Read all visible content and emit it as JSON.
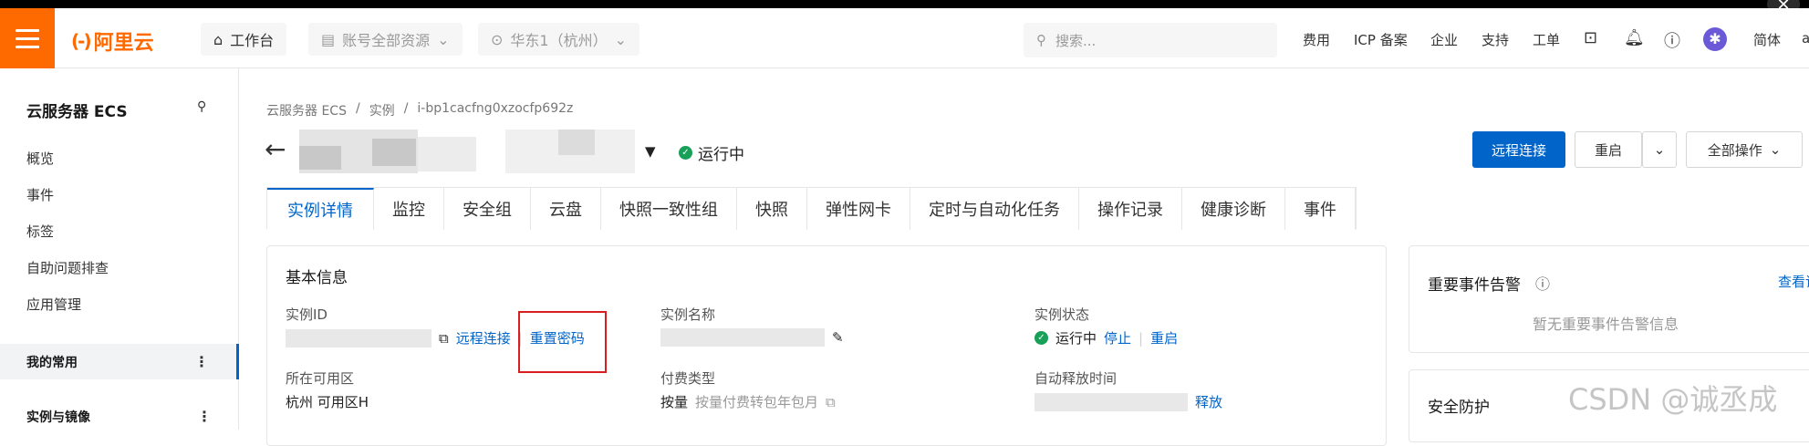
{
  "topbar": {
    "logo_mark": "(-)",
    "logo_text": "阿里云",
    "workbench": "工作台",
    "resources": "账号全部资源",
    "region": "华东1（杭州）",
    "search_placeholder": "搜索...",
    "links": [
      "费用",
      "ICP 备案",
      "企业",
      "支持",
      "工单"
    ],
    "lang": "简体",
    "user_initial": "a",
    "accent_color": "#ff6a00"
  },
  "sidebar": {
    "title": "云服务器 ECS",
    "items": [
      "概览",
      "事件",
      "标签",
      "自助问题排查",
      "应用管理"
    ],
    "sections": [
      "我的常用",
      "实例与镜像"
    ]
  },
  "breadcrumb": [
    "云服务器 ECS",
    "实例",
    "i-bp1cacfng0xzocfp692z"
  ],
  "status": "运行中",
  "actions": {
    "remote": "远程连接",
    "restart": "重启",
    "all_ops": "全部操作"
  },
  "tabs": [
    "实例详情",
    "监控",
    "安全组",
    "云盘",
    "快照一致性组",
    "快照",
    "弹性网卡",
    "定时与自动化任务",
    "操作记录",
    "健康诊断",
    "事件"
  ],
  "basic_info": {
    "title": "基本信息",
    "instance_id_label": "实例ID",
    "remote_link": "远程连接",
    "reset_password": "重置密码",
    "name_label": "实例名称",
    "state_label": "实例状态",
    "state_value": "运行中",
    "stop": "停止",
    "restart": "重启",
    "zone_label": "所在可用区",
    "zone_value": "杭州 可用区H",
    "billing_label": "付费类型",
    "billing_value": "按量",
    "billing_convert": "按量付费转包年包月",
    "release_label": "自动释放时间",
    "release": "释放"
  },
  "events_card": {
    "title": "重要事件告警",
    "view": "查看详",
    "empty": "暂无重要事件告警信息"
  },
  "security_card": {
    "title": "安全防护"
  },
  "watermark": "CSDN @诚丞成"
}
